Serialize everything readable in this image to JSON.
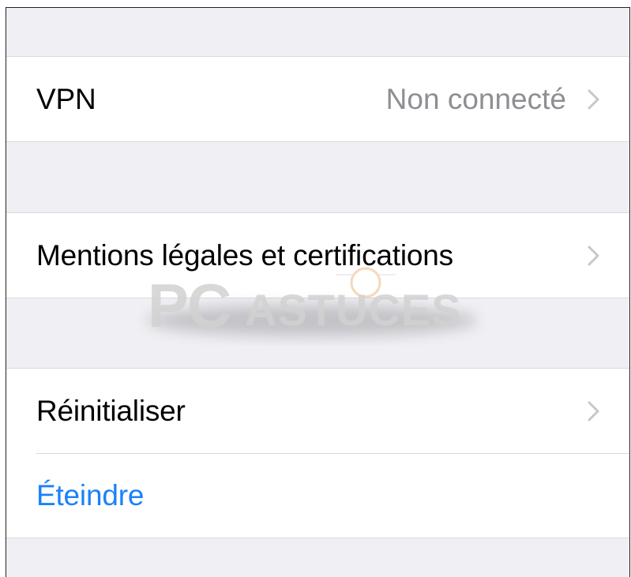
{
  "rows": {
    "vpn": {
      "label": "VPN",
      "value": "Non connecté"
    },
    "legal": {
      "label": "Mentions légales et certifications"
    },
    "reset": {
      "label": "Réinitialiser"
    },
    "shutdown": {
      "label": "Éteindre"
    }
  },
  "icons": {
    "chevron": "chevron-right-icon"
  },
  "colors": {
    "group_background": "#efeff4",
    "cell_background": "#ffffff",
    "label_text": "#000000",
    "secondary_text": "#8e8e93",
    "destructive_link": "#1a82f7",
    "chevron": "#c7c7cc"
  },
  "watermark": {
    "text": "PC ASTUCES"
  }
}
